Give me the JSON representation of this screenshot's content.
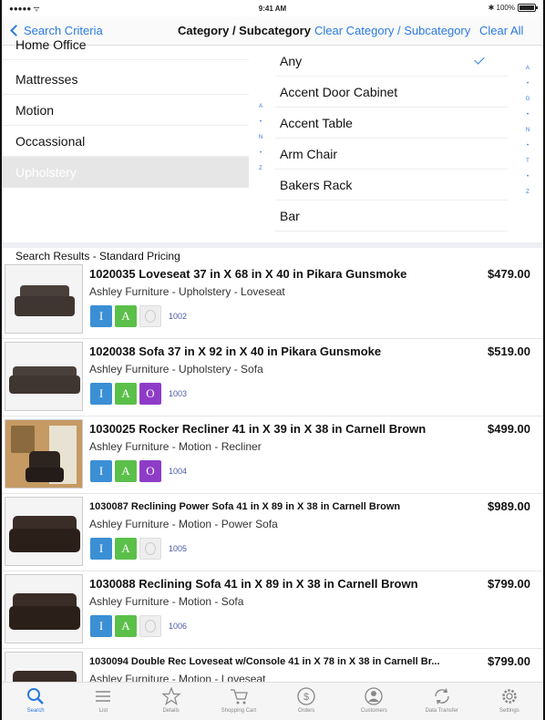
{
  "status_bar": {
    "signal": "●●●●● ᯤ",
    "time": "9:41 AM",
    "battery_text": "✱ 100%"
  },
  "nav": {
    "back_label": "Search Criteria",
    "title": "Category / Subcategory",
    "clear_category_label": "Clear Category / Subcategory",
    "clear_all_label": "Clear All"
  },
  "categories": [
    {
      "label": "Home Office",
      "selected": false
    },
    {
      "label": "Mattresses",
      "selected": false
    },
    {
      "label": "Motion",
      "selected": false
    },
    {
      "label": "Occassional",
      "selected": false
    },
    {
      "label": "Upholstery",
      "selected": true
    }
  ],
  "category_index": [
    "A",
    "•",
    "N",
    "•",
    "Z"
  ],
  "subcategories": [
    {
      "label": "Any",
      "checked": true
    },
    {
      "label": "Accent Door Cabinet",
      "checked": false
    },
    {
      "label": "Accent Table",
      "checked": false
    },
    {
      "label": "Arm Chair",
      "checked": false
    },
    {
      "label": "Bakers Rack",
      "checked": false
    },
    {
      "label": "Bar",
      "checked": false
    }
  ],
  "subcategory_index": [
    "A",
    "•",
    "G",
    "•",
    "N",
    "•",
    "T",
    "•",
    "Z"
  ],
  "results_header": "Search Results - Standard Pricing",
  "results": [
    {
      "title": "1020035 Loveseat 37 in X 68 in X 40 in Pikara Gunsmoke",
      "subtitle": "Ashley Furniture - Upholstery - Loveseat",
      "price": "$479.00",
      "code": "1002",
      "o_enabled": false,
      "image": "loveseat"
    },
    {
      "title": "1020038 Sofa 37 in X 92 in X 40 in Pikara Gunsmoke",
      "subtitle": "Ashley Furniture - Upholstery - Sofa",
      "price": "$519.00",
      "code": "1003",
      "o_enabled": true,
      "image": "sofa"
    },
    {
      "title": "1030025 Rocker Recliner 41 in X 39 in X 38 in Carnell Brown",
      "subtitle": "Ashley Furniture - Motion - Recliner",
      "price": "$499.00",
      "code": "1004",
      "o_enabled": true,
      "image": "recliner-room"
    },
    {
      "title": "1030087 Reclining Power Sofa 41 in X 89 in X 38 in Carnell Brown",
      "subtitle": "Ashley Furniture - Motion - Power Sofa",
      "price": "$989.00",
      "code": "1005",
      "o_enabled": false,
      "image": "reclining-sofa"
    },
    {
      "title": "1030088 Reclining Sofa 41 in X 89 in X 38 in Carnell Brown",
      "subtitle": "Ashley Furniture - Motion - Sofa",
      "price": "$799.00",
      "code": "1006",
      "o_enabled": false,
      "image": "reclining-sofa"
    },
    {
      "title": "1030094 Double Rec Loveseat w/Console 41 in X 78 in X 38 in Carnell Br...",
      "subtitle": "Ashley Furniture - Motion - Loveseat",
      "price": "$799.00",
      "code": "",
      "o_enabled": false,
      "image": "reclining-sofa"
    }
  ],
  "badge_letters": {
    "i": "I",
    "a": "A",
    "o": "O"
  },
  "tabs": [
    {
      "label": "Search",
      "icon": "search-icon",
      "active": true
    },
    {
      "label": "List",
      "icon": "list-icon",
      "active": false
    },
    {
      "label": "Details",
      "icon": "star-icon",
      "active": false
    },
    {
      "label": "Shopping Cart",
      "icon": "cart-icon",
      "active": false
    },
    {
      "label": "Orders",
      "icon": "dollar-icon",
      "active": false
    },
    {
      "label": "Customers",
      "icon": "person-icon",
      "active": false
    },
    {
      "label": "Data Transfer",
      "icon": "sync-icon",
      "active": false
    },
    {
      "label": "Settings",
      "icon": "gear-icon",
      "active": false
    }
  ],
  "colors": {
    "accent": "#2b7ae0",
    "badge_i": "#3b8fd4",
    "badge_a": "#5bc04a",
    "badge_o": "#8e3cc8"
  }
}
